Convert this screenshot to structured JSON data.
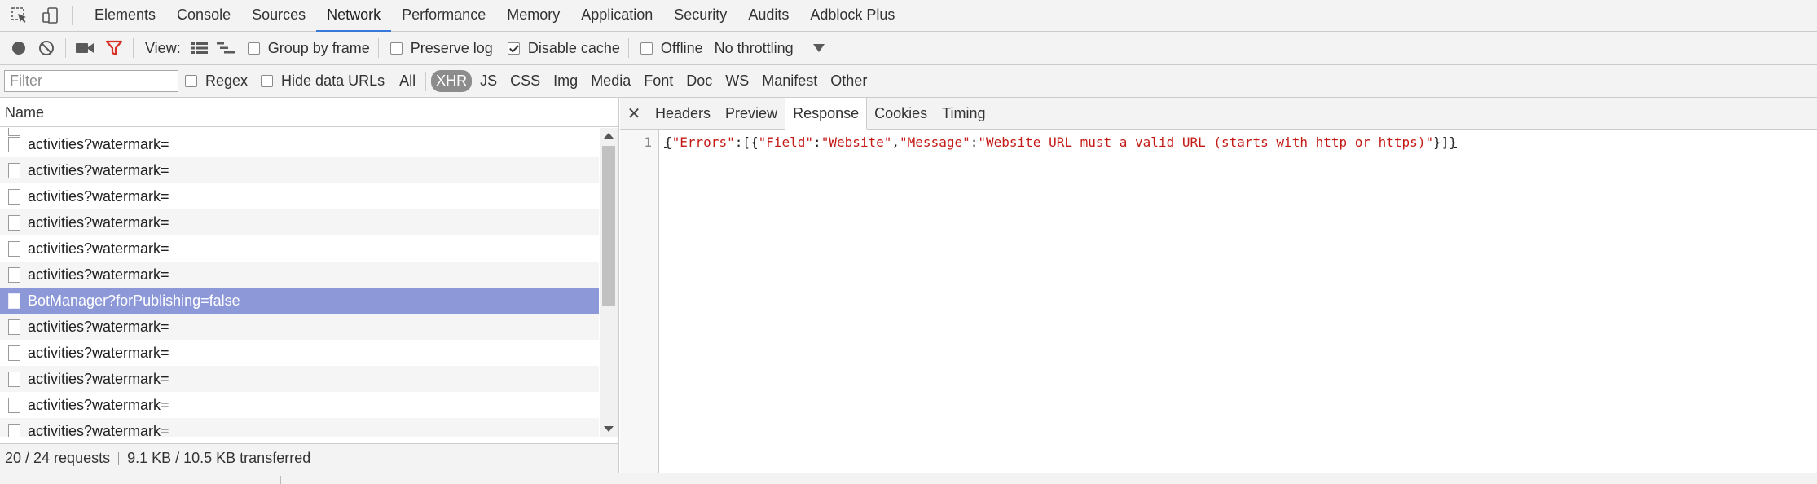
{
  "tabs": [
    {
      "label": "Elements"
    },
    {
      "label": "Console"
    },
    {
      "label": "Sources"
    },
    {
      "label": "Network",
      "active": true
    },
    {
      "label": "Performance"
    },
    {
      "label": "Memory"
    },
    {
      "label": "Application"
    },
    {
      "label": "Security"
    },
    {
      "label": "Audits"
    },
    {
      "label": "Adblock Plus"
    }
  ],
  "toolbar": {
    "view_label": "View:",
    "group_by_frame": {
      "label": "Group by frame",
      "checked": false
    },
    "preserve_log": {
      "label": "Preserve log",
      "checked": false
    },
    "disable_cache": {
      "label": "Disable cache",
      "checked": true
    },
    "offline": {
      "label": "Offline",
      "checked": false
    },
    "throttling": "No throttling"
  },
  "filterbar": {
    "placeholder": "Filter",
    "regex": {
      "label": "Regex",
      "checked": false
    },
    "hide_data_urls": {
      "label": "Hide data URLs",
      "checked": false
    },
    "types": [
      "All",
      "XHR",
      "JS",
      "CSS",
      "Img",
      "Media",
      "Font",
      "Doc",
      "WS",
      "Manifest",
      "Other"
    ],
    "active_type": "XHR"
  },
  "request_list": {
    "column_name": "Name",
    "rows": [
      {
        "name": "activities?watermark="
      },
      {
        "name": "activities?watermark="
      },
      {
        "name": "activities?watermark="
      },
      {
        "name": "activities?watermark="
      },
      {
        "name": "activities?watermark="
      },
      {
        "name": "activities?watermark="
      },
      {
        "name": "BotManager?forPublishing=false",
        "selected": true
      },
      {
        "name": "activities?watermark="
      },
      {
        "name": "activities?watermark="
      },
      {
        "name": "activities?watermark="
      },
      {
        "name": "activities?watermark="
      },
      {
        "name": "activities?watermark="
      }
    ]
  },
  "details": {
    "tabs": [
      "Headers",
      "Preview",
      "Response",
      "Cookies",
      "Timing"
    ],
    "active_tab": "Response",
    "response": {
      "line_number": "1",
      "tokens": [
        {
          "t": "{",
          "c": "brace"
        },
        {
          "t": "\"Errors\"",
          "c": "str"
        },
        {
          "t": ":[{",
          "c": "p"
        },
        {
          "t": "\"Field\"",
          "c": "str"
        },
        {
          "t": ":",
          "c": "p"
        },
        {
          "t": "\"Website\"",
          "c": "str"
        },
        {
          "t": ",",
          "c": "p"
        },
        {
          "t": "\"Message\"",
          "c": "str"
        },
        {
          "t": ":",
          "c": "p"
        },
        {
          "t": "\"Website URL must a valid URL (starts with http or https)\"",
          "c": "str"
        },
        {
          "t": "}]",
          "c": "p"
        },
        {
          "t": "}",
          "c": "brace"
        }
      ]
    }
  },
  "status": {
    "requests": "20 / 24 requests",
    "transferred": "9.1 KB / 10.5 KB transferred"
  },
  "colors": {
    "accent": "#3879d9",
    "selected_row": "#8d98d9",
    "record_filter_red": "#d93025",
    "json_string": "#c41a16"
  }
}
